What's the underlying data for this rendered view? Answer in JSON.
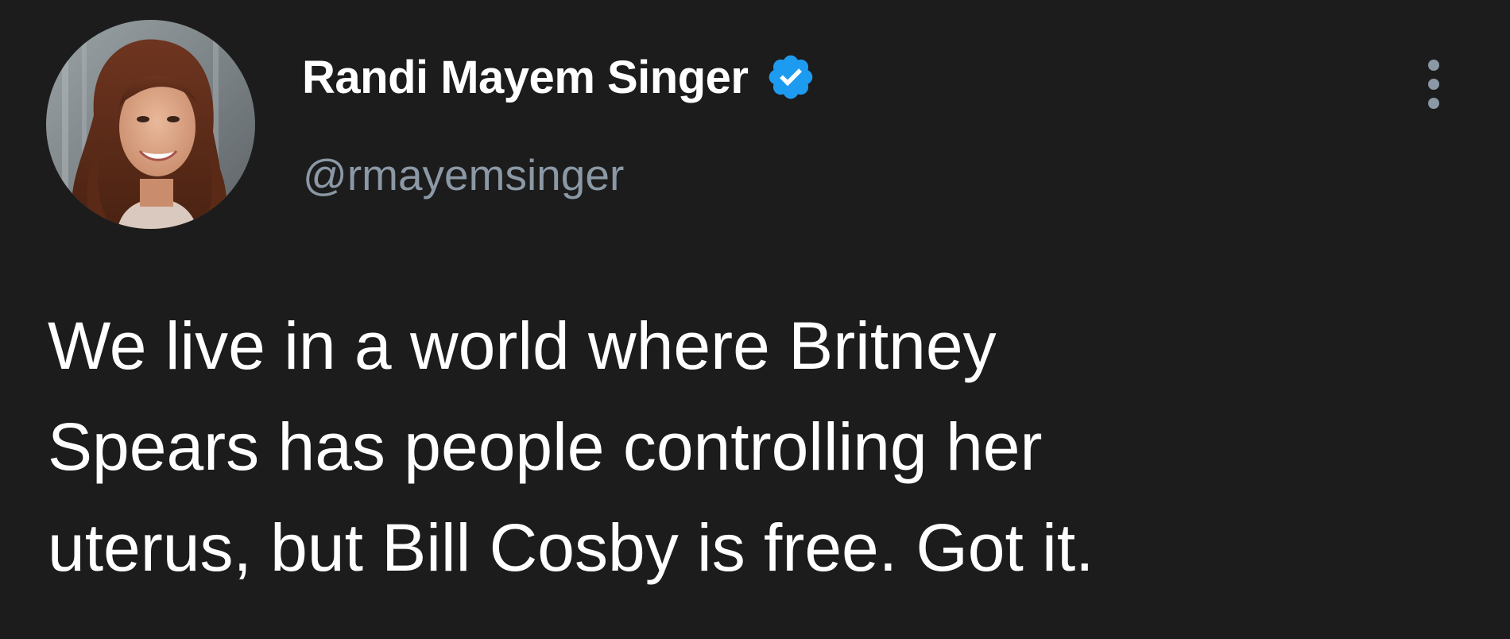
{
  "tweet": {
    "author": {
      "display_name": "Randi Mayem Singer",
      "handle": "@rmayemsinger",
      "verified": true,
      "avatar_icon": "profile-photo"
    },
    "text": "We live in a world where Britney\nSpears has people controlling her\nuterus, but Bill Cosby is free. Got it.",
    "more_icon": "more-vertical-icon"
  },
  "colors": {
    "background": "#1c1c1c",
    "primary_text": "#ffffff",
    "secondary_text": "#8b98a5",
    "verified_blue": "#1d9bf0"
  }
}
